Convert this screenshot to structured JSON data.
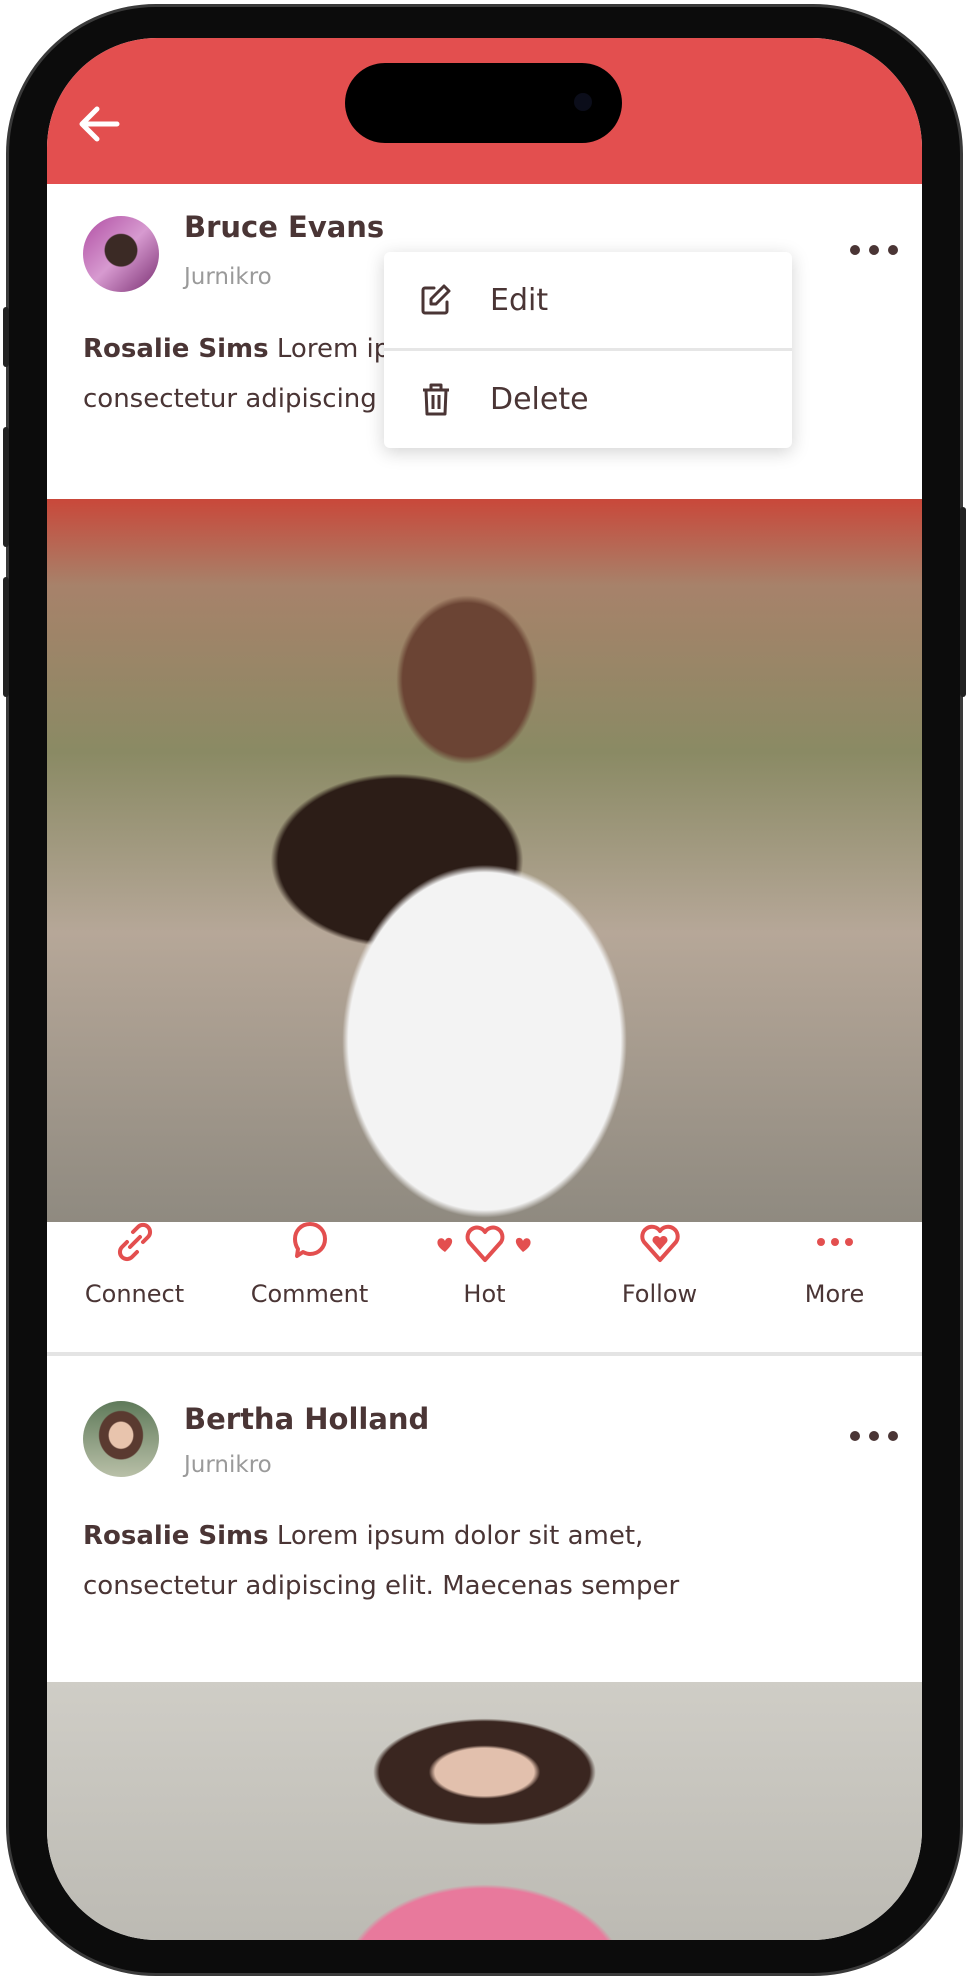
{
  "header": {
    "back_icon": "arrow-left-icon",
    "color": "#E34F4F"
  },
  "posts": [
    {
      "author": "Bruce Evans",
      "subtitle": "Jurnikro",
      "mention": "Rosalie Sims",
      "text_line1": " Lorem ipsum dolor sit amet,",
      "text_line2": "consectetur adipiscing elit. Maecenas semper"
    },
    {
      "author": "Bertha Holland",
      "subtitle": "Jurnikro",
      "mention": "Rosalie Sims",
      "text_line1": " Lorem ipsum dolor sit amet,",
      "text_line2": "consectetur adipiscing elit. Maecenas semper"
    }
  ],
  "actions": [
    {
      "label": "Connect",
      "icon": "link-icon"
    },
    {
      "label": "Comment",
      "icon": "chat-bubble-icon"
    },
    {
      "label": "Hot",
      "icon": "hearts-icon"
    },
    {
      "label": "Follow",
      "icon": "heart-in-heart-icon"
    },
    {
      "label": "More",
      "icon": "more-dots-icon"
    }
  ],
  "menu": {
    "edit": "Edit",
    "delete": "Delete"
  },
  "colors": {
    "accent": "#E34F4F",
    "text": "#4A3535"
  }
}
